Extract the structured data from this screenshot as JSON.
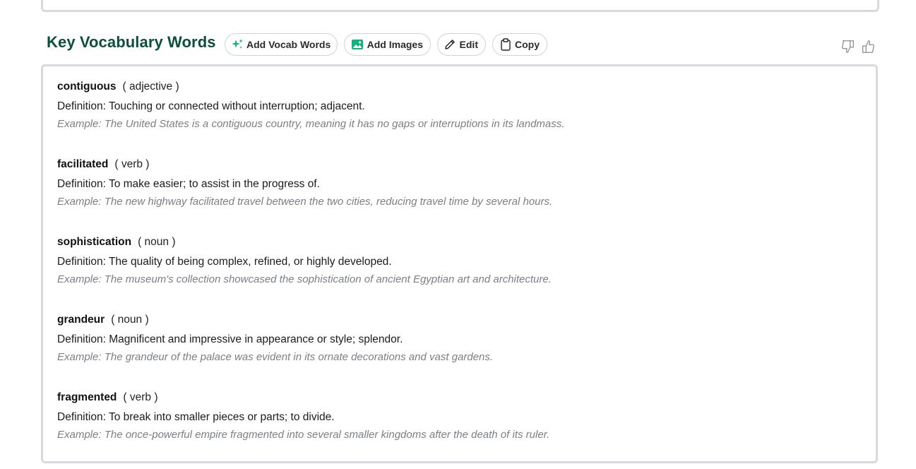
{
  "section": {
    "title": "Key Vocabulary Words"
  },
  "toolbar": {
    "add_vocab_label": "Add Vocab Words",
    "add_images_label": "Add Images",
    "edit_label": "Edit",
    "copy_label": "Copy",
    "accent_color": "#0d4f3f",
    "icon_green": "#18b07a"
  },
  "icons": {
    "add_vocab": "sparkle-icon",
    "add_images": "image-icon",
    "edit": "pencil-icon",
    "copy": "clipboard-icon",
    "thumbs_down": "thumbs-down-icon",
    "thumbs_up": "thumbs-up-icon"
  },
  "vocab": [
    {
      "word": "contiguous",
      "pos": "( adjective )",
      "definition": "Definition: Touching or connected without interruption; adjacent.",
      "example": "Example: The United States is a contiguous country, meaning it has no gaps or interruptions in its landmass."
    },
    {
      "word": "facilitated",
      "pos": "( verb )",
      "definition": "Definition: To make easier; to assist in the progress of.",
      "example": "Example: The new highway facilitated travel between the two cities, reducing travel time by several hours."
    },
    {
      "word": "sophistication",
      "pos": "( noun )",
      "definition": "Definition: The quality of being complex, refined, or highly developed.",
      "example": "Example: The museum's collection showcased the sophistication of ancient Egyptian art and architecture."
    },
    {
      "word": "grandeur",
      "pos": "( noun )",
      "definition": "Definition: Magnificent and impressive in appearance or style; splendor.",
      "example": "Example: The grandeur of the palace was evident in its ornate decorations and vast gardens."
    },
    {
      "word": "fragmented",
      "pos": "( verb )",
      "definition": "Definition: To break into smaller pieces or parts; to divide.",
      "example": "Example: The once-powerful empire fragmented into several smaller kingdoms after the death of its ruler."
    }
  ]
}
